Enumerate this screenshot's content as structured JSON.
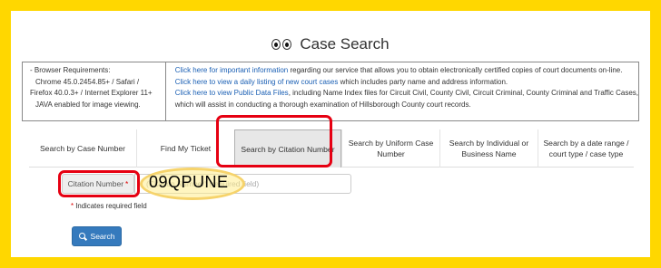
{
  "header": {
    "title": "Case Search"
  },
  "browser_requirements": {
    "lines": [
      "- Browser Requirements:",
      "Chrome 45.0.2454.85+ / Safari /",
      "Firefox 40.0.3+ / Internet Explorer 11+",
      "JAVA enabled for image viewing."
    ]
  },
  "info_links": [
    {
      "link": "Click here for important information",
      "text": " regarding our service that allows you to obtain electronically certified copies of court documents on-line."
    },
    {
      "link": "Click here to view a daily listing of new court cases",
      "text": " which includes party name and address information."
    },
    {
      "link": "Click here to view Public Data Files",
      "text": ", including Name Index files for Circuit Civil, County Civil, Circuit Criminal, County Criminal and Traffic Cases,"
    },
    {
      "link": "",
      "text": "which will assist in conducting a thorough examination of Hillsborough County court records."
    }
  ],
  "tabs": [
    {
      "label": "Search by Case Number"
    },
    {
      "label": "Find My Ticket"
    },
    {
      "label": "Search by Citation Number",
      "active": true
    },
    {
      "label": "Search by Uniform Case Number"
    },
    {
      "label": "Search by Individual or Business Name"
    },
    {
      "label": "Search by a date range / court type / case type"
    }
  ],
  "form": {
    "field_label": "Citation Number",
    "required_mark": "*",
    "input_placeholder": "(Citation Number) (required field)",
    "typed_overlay": "09QPUNE",
    "required_hint": "Indicates required field",
    "search_button": "Search"
  },
  "colors": {
    "frame": "#FFD700",
    "annotation_red": "#e60012",
    "link": "#1a5fb4",
    "button": "#357abd"
  }
}
